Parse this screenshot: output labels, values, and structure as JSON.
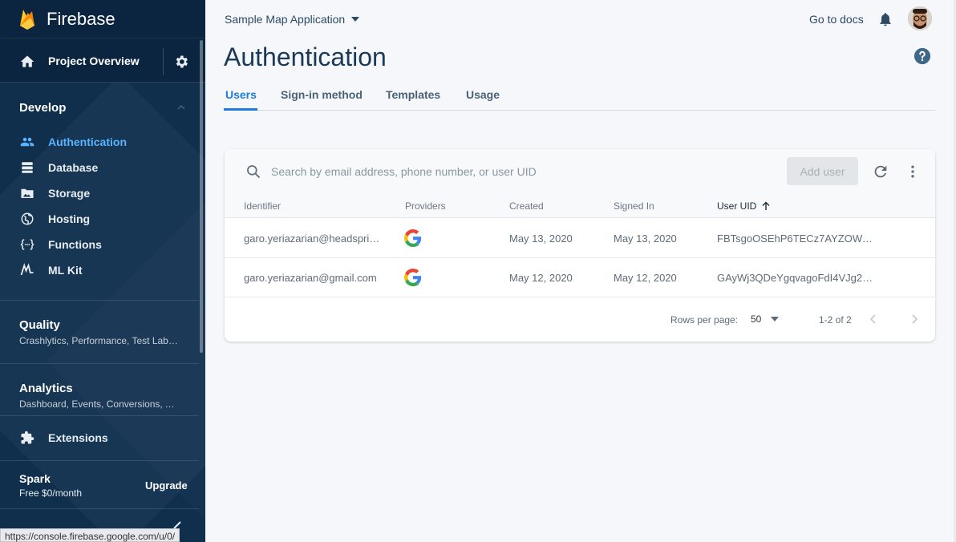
{
  "brand": {
    "name": "Firebase"
  },
  "sidebar": {
    "project_overview": "Project Overview",
    "develop": {
      "title": "Develop",
      "items": [
        {
          "label": "Authentication",
          "icon": "people-icon",
          "active": true
        },
        {
          "label": "Database",
          "icon": "database-icon",
          "active": false
        },
        {
          "label": "Storage",
          "icon": "photo-folder-icon",
          "active": false
        },
        {
          "label": "Hosting",
          "icon": "globe-icon",
          "active": false
        },
        {
          "label": "Functions",
          "icon": "functions-icon",
          "active": false
        },
        {
          "label": "ML Kit",
          "icon": "ml-kit-icon",
          "active": false
        }
      ]
    },
    "quality": {
      "title": "Quality",
      "subtitle": "Crashlytics, Performance, Test Lab, App Distribution"
    },
    "analytics": {
      "title": "Analytics",
      "subtitle": "Dashboard, Events, Conversions, Audiences"
    },
    "extensions": "Extensions",
    "plan": {
      "name": "Spark",
      "price": "Free $0/month",
      "upgrade": "Upgrade"
    }
  },
  "status_bar": {
    "url": "https://console.firebase.google.com/u/0/"
  },
  "header": {
    "project_name": "Sample Map Application",
    "docs_link": "Go to docs"
  },
  "page": {
    "title": "Authentication"
  },
  "tabs": [
    {
      "label": "Users",
      "active": true
    },
    {
      "label": "Sign-in method",
      "active": false
    },
    {
      "label": "Templates",
      "active": false
    },
    {
      "label": "Usage",
      "active": false
    }
  ],
  "users_table": {
    "search_placeholder": "Search by email address, phone number, or user UID",
    "add_user": "Add user",
    "columns": [
      "Identifier",
      "Providers",
      "Created",
      "Signed In",
      "User UID"
    ],
    "sorted_column": "User UID",
    "rows": [
      {
        "identifier": "garo.yeriazarian@headspring.com",
        "provider": "google",
        "created": "May 13, 2020",
        "signed_in": "May 13, 2020",
        "uid": "FBTsgoOSEhP6TECz7AYZOWu…"
      },
      {
        "identifier": "garo.yeriazarian@gmail.com",
        "provider": "google",
        "created": "May 12, 2020",
        "signed_in": "May 12, 2020",
        "uid": "GAyWj3QDeYgqvagoFdI4VJg2…"
      }
    ],
    "footer": {
      "rows_per_page_label": "Rows per page:",
      "rows_per_page": "50",
      "range": "1-2 of 2"
    }
  },
  "colors": {
    "sidebar_bg": "#0f2f4d",
    "accent": "#1e7bd9",
    "active_nav": "#5ab4ff"
  }
}
